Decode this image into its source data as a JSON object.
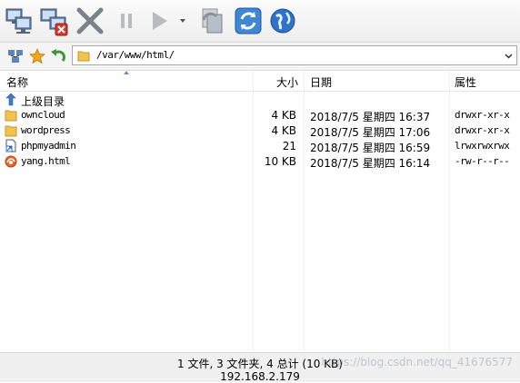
{
  "address": {
    "path": "/var/www/html/"
  },
  "columns": {
    "name": "名称",
    "size": "大小",
    "date": "日期",
    "attr": "属性"
  },
  "rows": [
    {
      "name": "上级目录",
      "size": "",
      "date": "",
      "attr": "",
      "icon": "up-dir-icon"
    },
    {
      "name": "owncloud",
      "size": "4 KB",
      "date": "2018/7/5 星期四 16:37",
      "attr": "drwxr-xr-x",
      "icon": "folder-icon"
    },
    {
      "name": "wordpress",
      "size": "4 KB",
      "date": "2018/7/5 星期四 17:06",
      "attr": "drwxr-xr-x",
      "icon": "folder-icon"
    },
    {
      "name": "phpmyadmin",
      "size": "21",
      "date": "2018/7/5 星期四 16:59",
      "attr": "lrwxrwxrwx",
      "icon": "symlink-icon"
    },
    {
      "name": "yang.html",
      "size": "10 KB",
      "date": "2018/7/5 星期四 16:14",
      "attr": "-rw-r--r--",
      "icon": "html-file-icon"
    }
  ],
  "status": {
    "summary": "1 文件, 3 文件夹, 4 总计 (10 KB)",
    "host": "192.168.2.179",
    "watermark": "https://blog.csdn.net/qq_41676577"
  },
  "colors": {
    "folder": "#f2c14e",
    "accent": "#2f6fc0"
  }
}
